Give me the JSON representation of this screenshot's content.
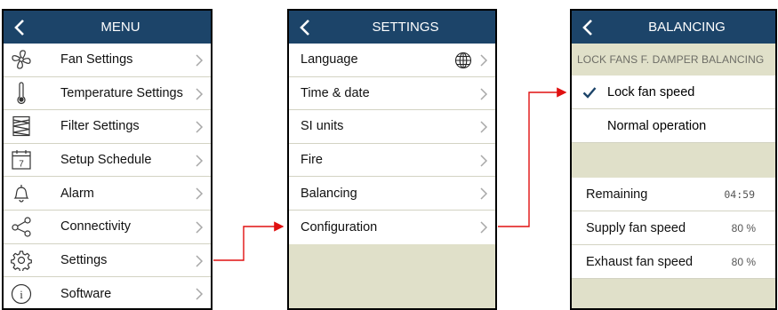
{
  "menu": {
    "title": "MENU",
    "items": [
      {
        "label": "Fan Settings",
        "icon": "fan-icon"
      },
      {
        "label": "Temperature Settings",
        "icon": "thermometer-icon"
      },
      {
        "label": "Filter Settings",
        "icon": "filter-icon"
      },
      {
        "label": "Setup Schedule",
        "icon": "calendar-icon",
        "icon_text": "7"
      },
      {
        "label": "Alarm",
        "icon": "bell-icon"
      },
      {
        "label": "Connectivity",
        "icon": "share-icon"
      },
      {
        "label": "Settings",
        "icon": "gear-icon"
      },
      {
        "label": "Software",
        "icon": "info-icon",
        "icon_text": "i"
      }
    ]
  },
  "settings": {
    "title": "SETTINGS",
    "items": [
      {
        "label": "Language",
        "icon": "globe-icon"
      },
      {
        "label": "Time & date"
      },
      {
        "label": "SI units"
      },
      {
        "label": "Fire"
      },
      {
        "label": "Balancing"
      },
      {
        "label": "Configuration"
      }
    ]
  },
  "balancing": {
    "title": "BALANCING",
    "section_label": "LOCK FANS F. DAMPER BALANCING",
    "options": [
      {
        "label": "Lock fan speed",
        "selected": true
      },
      {
        "label": "Normal operation",
        "selected": false
      }
    ],
    "readouts": [
      {
        "label": "Remaining",
        "value": "04:59"
      },
      {
        "label": "Supply fan speed",
        "value": "80 %"
      },
      {
        "label": "Exhaust fan speed",
        "value": "80 %"
      }
    ]
  },
  "colors": {
    "header": "#1c4469",
    "background": "#e0e0c9",
    "connector": "#e01010",
    "check": "#1c4469"
  }
}
